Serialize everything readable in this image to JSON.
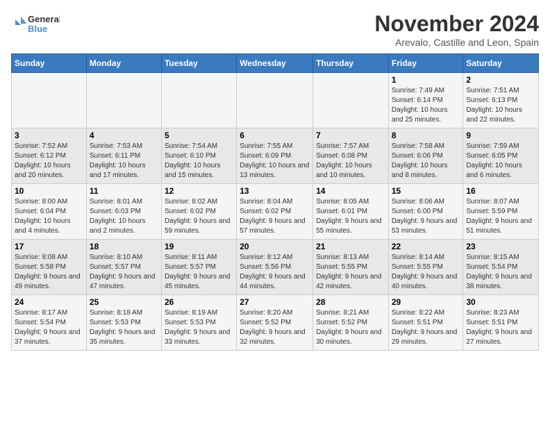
{
  "logo": {
    "line1": "General",
    "line2": "Blue"
  },
  "title": "November 2024",
  "subtitle": "Arevalo, Castille and Leon, Spain",
  "weekdays": [
    "Sunday",
    "Monday",
    "Tuesday",
    "Wednesday",
    "Thursday",
    "Friday",
    "Saturday"
  ],
  "weeks": [
    [
      {
        "day": "",
        "info": ""
      },
      {
        "day": "",
        "info": ""
      },
      {
        "day": "",
        "info": ""
      },
      {
        "day": "",
        "info": ""
      },
      {
        "day": "",
        "info": ""
      },
      {
        "day": "1",
        "info": "Sunrise: 7:49 AM\nSunset: 6:14 PM\nDaylight: 10 hours and 25 minutes."
      },
      {
        "day": "2",
        "info": "Sunrise: 7:51 AM\nSunset: 6:13 PM\nDaylight: 10 hours and 22 minutes."
      }
    ],
    [
      {
        "day": "3",
        "info": "Sunrise: 7:52 AM\nSunset: 6:12 PM\nDaylight: 10 hours and 20 minutes."
      },
      {
        "day": "4",
        "info": "Sunrise: 7:53 AM\nSunset: 6:11 PM\nDaylight: 10 hours and 17 minutes."
      },
      {
        "day": "5",
        "info": "Sunrise: 7:54 AM\nSunset: 6:10 PM\nDaylight: 10 hours and 15 minutes."
      },
      {
        "day": "6",
        "info": "Sunrise: 7:55 AM\nSunset: 6:09 PM\nDaylight: 10 hours and 13 minutes."
      },
      {
        "day": "7",
        "info": "Sunrise: 7:57 AM\nSunset: 6:08 PM\nDaylight: 10 hours and 10 minutes."
      },
      {
        "day": "8",
        "info": "Sunrise: 7:58 AM\nSunset: 6:06 PM\nDaylight: 10 hours and 8 minutes."
      },
      {
        "day": "9",
        "info": "Sunrise: 7:59 AM\nSunset: 6:05 PM\nDaylight: 10 hours and 6 minutes."
      }
    ],
    [
      {
        "day": "10",
        "info": "Sunrise: 8:00 AM\nSunset: 6:04 PM\nDaylight: 10 hours and 4 minutes."
      },
      {
        "day": "11",
        "info": "Sunrise: 8:01 AM\nSunset: 6:03 PM\nDaylight: 10 hours and 2 minutes."
      },
      {
        "day": "12",
        "info": "Sunrise: 8:02 AM\nSunset: 6:02 PM\nDaylight: 9 hours and 59 minutes."
      },
      {
        "day": "13",
        "info": "Sunrise: 8:04 AM\nSunset: 6:02 PM\nDaylight: 9 hours and 57 minutes."
      },
      {
        "day": "14",
        "info": "Sunrise: 8:05 AM\nSunset: 6:01 PM\nDaylight: 9 hours and 55 minutes."
      },
      {
        "day": "15",
        "info": "Sunrise: 8:06 AM\nSunset: 6:00 PM\nDaylight: 9 hours and 53 minutes."
      },
      {
        "day": "16",
        "info": "Sunrise: 8:07 AM\nSunset: 5:59 PM\nDaylight: 9 hours and 51 minutes."
      }
    ],
    [
      {
        "day": "17",
        "info": "Sunrise: 8:08 AM\nSunset: 5:58 PM\nDaylight: 9 hours and 49 minutes."
      },
      {
        "day": "18",
        "info": "Sunrise: 8:10 AM\nSunset: 5:57 PM\nDaylight: 9 hours and 47 minutes."
      },
      {
        "day": "19",
        "info": "Sunrise: 8:11 AM\nSunset: 5:57 PM\nDaylight: 9 hours and 45 minutes."
      },
      {
        "day": "20",
        "info": "Sunrise: 8:12 AM\nSunset: 5:56 PM\nDaylight: 9 hours and 44 minutes."
      },
      {
        "day": "21",
        "info": "Sunrise: 8:13 AM\nSunset: 5:55 PM\nDaylight: 9 hours and 42 minutes."
      },
      {
        "day": "22",
        "info": "Sunrise: 8:14 AM\nSunset: 5:55 PM\nDaylight: 9 hours and 40 minutes."
      },
      {
        "day": "23",
        "info": "Sunrise: 8:15 AM\nSunset: 5:54 PM\nDaylight: 9 hours and 38 minutes."
      }
    ],
    [
      {
        "day": "24",
        "info": "Sunrise: 8:17 AM\nSunset: 5:54 PM\nDaylight: 9 hours and 37 minutes."
      },
      {
        "day": "25",
        "info": "Sunrise: 8:18 AM\nSunset: 5:53 PM\nDaylight: 9 hours and 35 minutes."
      },
      {
        "day": "26",
        "info": "Sunrise: 8:19 AM\nSunset: 5:53 PM\nDaylight: 9 hours and 33 minutes."
      },
      {
        "day": "27",
        "info": "Sunrise: 8:20 AM\nSunset: 5:52 PM\nDaylight: 9 hours and 32 minutes."
      },
      {
        "day": "28",
        "info": "Sunrise: 8:21 AM\nSunset: 5:52 PM\nDaylight: 9 hours and 30 minutes."
      },
      {
        "day": "29",
        "info": "Sunrise: 8:22 AM\nSunset: 5:51 PM\nDaylight: 9 hours and 29 minutes."
      },
      {
        "day": "30",
        "info": "Sunrise: 8:23 AM\nSunset: 5:51 PM\nDaylight: 9 hours and 27 minutes."
      }
    ]
  ]
}
